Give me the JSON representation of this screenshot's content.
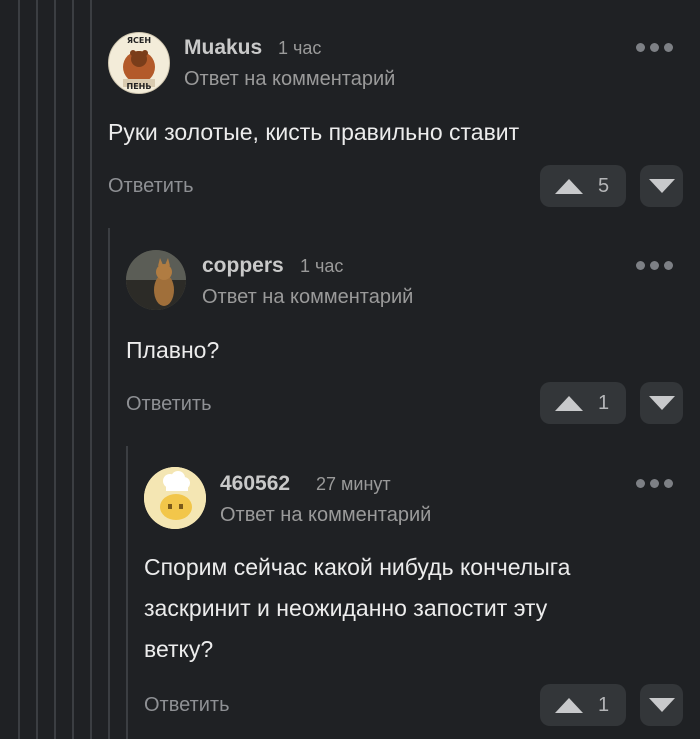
{
  "comments": [
    {
      "username": "Muakus",
      "time": "1 час",
      "reply_note": "Ответ на комментарий",
      "avatar_icon": "bear-avatar-icon",
      "avatar_text_top": "ЯСЕН",
      "avatar_text_bottom": "ПЕНЬ",
      "text_lines": [
        "Руки золотые, кисть правильно ставит"
      ],
      "reply_label": "Ответить",
      "rating": "5"
    },
    {
      "username": "coppers",
      "time": "1 час",
      "reply_note": "Ответ на комментарий",
      "avatar_icon": "cat-avatar-icon",
      "text_lines": [
        "Плавно?"
      ],
      "reply_label": "Ответить",
      "rating": "1"
    },
    {
      "username": "460562",
      "time": "27 минут",
      "reply_note": "Ответ на комментарий",
      "avatar_icon": "chef-avatar-icon",
      "text_lines": [
        "Спорим сейчас какой нибудь кончелыга",
        "заскринит и неожиданно запостит эту",
        "ветку?"
      ],
      "reply_label": "Ответить",
      "rating": "1"
    }
  ],
  "colors": {
    "background": "#1f2124",
    "button_bg": "#333639",
    "thread_line": "#3b3e42"
  }
}
